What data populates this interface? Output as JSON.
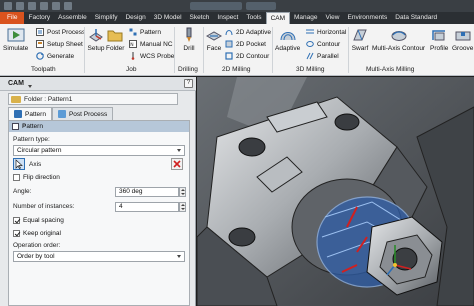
{
  "menu": {
    "tabs": [
      "File",
      "Factory",
      "Assemble",
      "Simplify",
      "Design",
      "3D Model",
      "Sketch",
      "Inspect",
      "Tools",
      "CAM",
      "Manage",
      "View",
      "Environments",
      "Data Standard"
    ],
    "active_tab": "CAM"
  },
  "ribbon": {
    "toolpath": {
      "simulate": "Simulate",
      "post_process": "Post Process",
      "setup_sheet": "Setup Sheet",
      "generate": "Generate",
      "label": "Toolpath"
    },
    "job": {
      "setup": "Setup",
      "folder": "Folder",
      "pattern": "Pattern",
      "manual_nc": "Manual NC",
      "wcs_probe": "WCS Probe",
      "label": "Job"
    },
    "drilling": {
      "drill": "Drill",
      "label": "Drilling"
    },
    "milling_2d": {
      "face": "Face",
      "adaptive": "2D Adaptive",
      "pocket": "2D Pocket",
      "contour": "2D Contour",
      "label": "2D Milling"
    },
    "milling_3d": {
      "adaptive": "Adaptive",
      "horizontal": "Horizontal",
      "contour": "Contour",
      "parallel": "Parallel",
      "label": "3D Milling"
    },
    "multi_axis": {
      "swarf": "Swarf",
      "multi_axis_contour": "Multi-Axis Contour",
      "profile": "Profile",
      "groove": "Groove",
      "label": "Multi-Axis Milling"
    }
  },
  "panel": {
    "title": "CAM",
    "help": "?",
    "folder_path": "Folder : Pattern1",
    "tabs": [
      "Pattern",
      "Post Process"
    ],
    "group_title": "Pattern",
    "pattern_type_label": "Pattern type:",
    "pattern_type_value": "Circular pattern",
    "axis_label": "Axis",
    "flip_direction": "Flip direction",
    "angle_label": "Angle:",
    "angle_value": "360 deg",
    "instances_label": "Number of instances:",
    "instances_value": "4",
    "equal_spacing": "Equal spacing",
    "keep_original": "Keep original",
    "operation_order_label": "Operation order:",
    "operation_order_value": "Order by tool",
    "checkbox_state": {
      "flip_direction": false,
      "equal_spacing": true,
      "keep_original": true
    }
  },
  "colors": {
    "file_tab": "#d9531e",
    "group_header": "#b6c7d9",
    "blue_highlight": "#2e6fb4",
    "viewport_bg": "#777c80"
  }
}
